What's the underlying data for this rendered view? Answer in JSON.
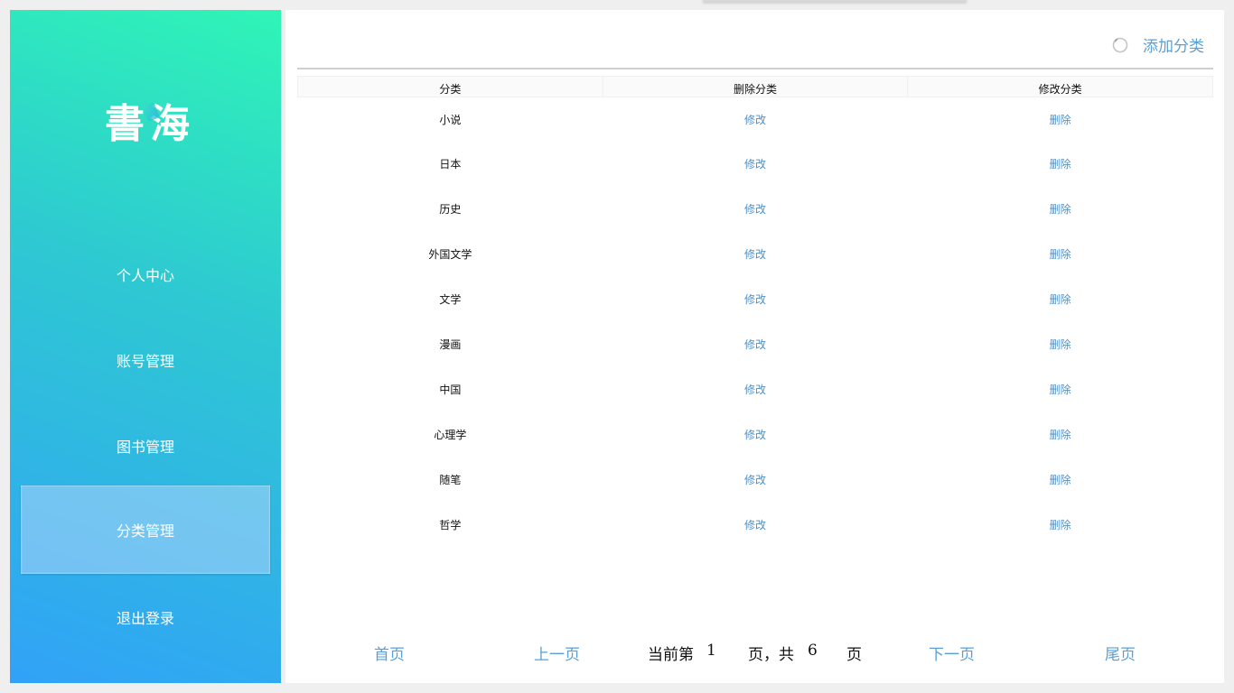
{
  "app": {
    "logo_text_1": "書",
    "logo_text_2": "海"
  },
  "sidebar": {
    "items": [
      {
        "label": "个人中心",
        "active": false
      },
      {
        "label": "账号管理",
        "active": false
      },
      {
        "label": "图书管理",
        "active": false
      },
      {
        "label": "分类管理",
        "active": true
      },
      {
        "label": "退出登录",
        "active": false
      }
    ]
  },
  "toolbar": {
    "add_label": "添加分类",
    "icon": "search-icon"
  },
  "table": {
    "headers": [
      "分类",
      "删除分类",
      "修改分类"
    ],
    "rows": [
      {
        "category": "小说",
        "edit": "修改",
        "delete": "删除"
      },
      {
        "category": "日本",
        "edit": "修改",
        "delete": "删除"
      },
      {
        "category": "历史",
        "edit": "修改",
        "delete": "删除"
      },
      {
        "category": "外国文学",
        "edit": "修改",
        "delete": "删除"
      },
      {
        "category": "文学",
        "edit": "修改",
        "delete": "删除"
      },
      {
        "category": "漫画",
        "edit": "修改",
        "delete": "删除"
      },
      {
        "category": "中国",
        "edit": "修改",
        "delete": "删除"
      },
      {
        "category": "心理学",
        "edit": "修改",
        "delete": "删除"
      },
      {
        "category": "随笔",
        "edit": "修改",
        "delete": "删除"
      },
      {
        "category": "哲学",
        "edit": "修改",
        "delete": "删除"
      }
    ]
  },
  "pager": {
    "first": "首页",
    "prev": "上一页",
    "current_prefix": "当前第",
    "current_page": "1",
    "middle": "页，共",
    "total_pages": "6",
    "suffix": "页",
    "next": "下一页",
    "last": "尾页"
  },
  "colors": {
    "link": "#4f8fc7",
    "sidebar_top": "#2ff5b6",
    "sidebar_bottom": "#31a2f7"
  }
}
